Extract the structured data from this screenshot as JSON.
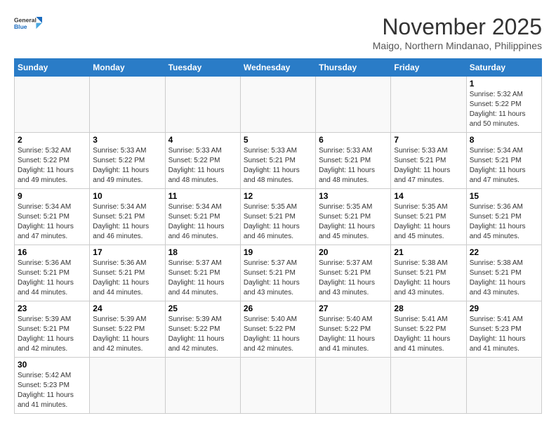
{
  "header": {
    "logo_general": "General",
    "logo_blue": "Blue",
    "month_title": "November 2025",
    "location": "Maigo, Northern Mindanao, Philippines"
  },
  "weekdays": [
    "Sunday",
    "Monday",
    "Tuesday",
    "Wednesday",
    "Thursday",
    "Friday",
    "Saturday"
  ],
  "weeks": [
    [
      {
        "day": "",
        "info": ""
      },
      {
        "day": "",
        "info": ""
      },
      {
        "day": "",
        "info": ""
      },
      {
        "day": "",
        "info": ""
      },
      {
        "day": "",
        "info": ""
      },
      {
        "day": "",
        "info": ""
      },
      {
        "day": "1",
        "info": "Sunrise: 5:32 AM\nSunset: 5:22 PM\nDaylight: 11 hours\nand 50 minutes."
      }
    ],
    [
      {
        "day": "2",
        "info": "Sunrise: 5:32 AM\nSunset: 5:22 PM\nDaylight: 11 hours\nand 49 minutes."
      },
      {
        "day": "3",
        "info": "Sunrise: 5:33 AM\nSunset: 5:22 PM\nDaylight: 11 hours\nand 49 minutes."
      },
      {
        "day": "4",
        "info": "Sunrise: 5:33 AM\nSunset: 5:22 PM\nDaylight: 11 hours\nand 48 minutes."
      },
      {
        "day": "5",
        "info": "Sunrise: 5:33 AM\nSunset: 5:21 PM\nDaylight: 11 hours\nand 48 minutes."
      },
      {
        "day": "6",
        "info": "Sunrise: 5:33 AM\nSunset: 5:21 PM\nDaylight: 11 hours\nand 48 minutes."
      },
      {
        "day": "7",
        "info": "Sunrise: 5:33 AM\nSunset: 5:21 PM\nDaylight: 11 hours\nand 47 minutes."
      },
      {
        "day": "8",
        "info": "Sunrise: 5:34 AM\nSunset: 5:21 PM\nDaylight: 11 hours\nand 47 minutes."
      }
    ],
    [
      {
        "day": "9",
        "info": "Sunrise: 5:34 AM\nSunset: 5:21 PM\nDaylight: 11 hours\nand 47 minutes."
      },
      {
        "day": "10",
        "info": "Sunrise: 5:34 AM\nSunset: 5:21 PM\nDaylight: 11 hours\nand 46 minutes."
      },
      {
        "day": "11",
        "info": "Sunrise: 5:34 AM\nSunset: 5:21 PM\nDaylight: 11 hours\nand 46 minutes."
      },
      {
        "day": "12",
        "info": "Sunrise: 5:35 AM\nSunset: 5:21 PM\nDaylight: 11 hours\nand 46 minutes."
      },
      {
        "day": "13",
        "info": "Sunrise: 5:35 AM\nSunset: 5:21 PM\nDaylight: 11 hours\nand 45 minutes."
      },
      {
        "day": "14",
        "info": "Sunrise: 5:35 AM\nSunset: 5:21 PM\nDaylight: 11 hours\nand 45 minutes."
      },
      {
        "day": "15",
        "info": "Sunrise: 5:36 AM\nSunset: 5:21 PM\nDaylight: 11 hours\nand 45 minutes."
      }
    ],
    [
      {
        "day": "16",
        "info": "Sunrise: 5:36 AM\nSunset: 5:21 PM\nDaylight: 11 hours\nand 44 minutes."
      },
      {
        "day": "17",
        "info": "Sunrise: 5:36 AM\nSunset: 5:21 PM\nDaylight: 11 hours\nand 44 minutes."
      },
      {
        "day": "18",
        "info": "Sunrise: 5:37 AM\nSunset: 5:21 PM\nDaylight: 11 hours\nand 44 minutes."
      },
      {
        "day": "19",
        "info": "Sunrise: 5:37 AM\nSunset: 5:21 PM\nDaylight: 11 hours\nand 43 minutes."
      },
      {
        "day": "20",
        "info": "Sunrise: 5:37 AM\nSunset: 5:21 PM\nDaylight: 11 hours\nand 43 minutes."
      },
      {
        "day": "21",
        "info": "Sunrise: 5:38 AM\nSunset: 5:21 PM\nDaylight: 11 hours\nand 43 minutes."
      },
      {
        "day": "22",
        "info": "Sunrise: 5:38 AM\nSunset: 5:21 PM\nDaylight: 11 hours\nand 43 minutes."
      }
    ],
    [
      {
        "day": "23",
        "info": "Sunrise: 5:39 AM\nSunset: 5:21 PM\nDaylight: 11 hours\nand 42 minutes."
      },
      {
        "day": "24",
        "info": "Sunrise: 5:39 AM\nSunset: 5:22 PM\nDaylight: 11 hours\nand 42 minutes."
      },
      {
        "day": "25",
        "info": "Sunrise: 5:39 AM\nSunset: 5:22 PM\nDaylight: 11 hours\nand 42 minutes."
      },
      {
        "day": "26",
        "info": "Sunrise: 5:40 AM\nSunset: 5:22 PM\nDaylight: 11 hours\nand 42 minutes."
      },
      {
        "day": "27",
        "info": "Sunrise: 5:40 AM\nSunset: 5:22 PM\nDaylight: 11 hours\nand 41 minutes."
      },
      {
        "day": "28",
        "info": "Sunrise: 5:41 AM\nSunset: 5:22 PM\nDaylight: 11 hours\nand 41 minutes."
      },
      {
        "day": "29",
        "info": "Sunrise: 5:41 AM\nSunset: 5:23 PM\nDaylight: 11 hours\nand 41 minutes."
      }
    ],
    [
      {
        "day": "30",
        "info": "Sunrise: 5:42 AM\nSunset: 5:23 PM\nDaylight: 11 hours\nand 41 minutes."
      },
      {
        "day": "",
        "info": ""
      },
      {
        "day": "",
        "info": ""
      },
      {
        "day": "",
        "info": ""
      },
      {
        "day": "",
        "info": ""
      },
      {
        "day": "",
        "info": ""
      },
      {
        "day": "",
        "info": ""
      }
    ]
  ]
}
